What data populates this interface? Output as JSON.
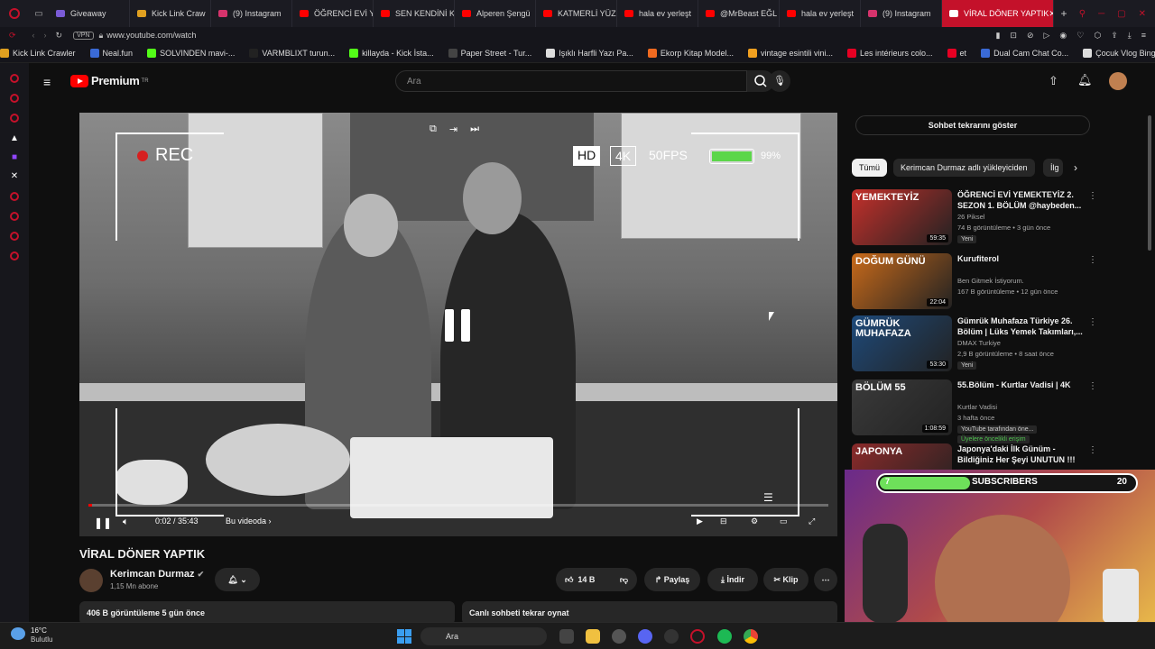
{
  "browser": {
    "tabs": [
      {
        "label": "Giveaway",
        "color": "#7a5bd6"
      },
      {
        "label": "Kick Link Craw",
        "color": "#e0a020"
      },
      {
        "label": "(9) Instagram",
        "color": "#d6336c"
      },
      {
        "label": "ÖĞRENCİ EVİ Y",
        "color": "#ff0000"
      },
      {
        "label": "SEN KENDİNİ K",
        "color": "#ff0000"
      },
      {
        "label": "Alperen Şengü",
        "color": "#ff0000"
      },
      {
        "label": "KATMERLİ YÜZ",
        "color": "#ff0000"
      },
      {
        "label": "hala ev yerleşt",
        "color": "#ff0000"
      },
      {
        "label": "@MrBeast EĞL",
        "color": "#ff0000"
      },
      {
        "label": "hala ev yerleşt",
        "color": "#ff0000"
      },
      {
        "label": "(9) Instagram",
        "color": "#d6336c"
      }
    ],
    "active_tab": "VİRAL DÖNER YAPTIK",
    "vpn_label": "VPN",
    "url": "www.youtube.com/watch",
    "bookmarks": [
      {
        "label": "Kick Link Crawler",
        "color": "#e0a020"
      },
      {
        "label": "Neal.fun",
        "color": "#3a6ad6"
      },
      {
        "label": "SOLVINDEN mavi-...",
        "color": "#53fc18"
      },
      {
        "label": "VARMBLIXT turun...",
        "color": "#222"
      },
      {
        "label": "killayda - Kick İsta...",
        "color": "#53fc18"
      },
      {
        "label": "Paper Street - Tur...",
        "color": "#444"
      },
      {
        "label": "Işıklı Harfli Yazı Pa...",
        "color": "#ddd"
      },
      {
        "label": "Ekorp Kitap Model...",
        "color": "#f06a20"
      },
      {
        "label": "vintage esintili vini...",
        "color": "#f0a020"
      },
      {
        "label": "Les intérieurs colo...",
        "color": "#e60023"
      },
      {
        "label": "et",
        "color": "#e60023"
      },
      {
        "label": "Dual Cam Chat Co...",
        "color": "#3a6ad6"
      },
      {
        "label": "Çocuk Vlog Bingosu",
        "color": "#ddd"
      }
    ]
  },
  "youtube": {
    "logo_text": "Premium",
    "logo_sup": "TR",
    "search_placeholder": "Ara"
  },
  "video": {
    "rec_label": "REC",
    "hd_label": "HD",
    "k4_label": "4K",
    "fps_label": "50FPS",
    "battery_pct": "99%",
    "time": "0:02 / 35:43",
    "chapter": "Bu videoda",
    "progress_fraction": 0.001
  },
  "meta": {
    "title": "VİRAL DÖNER YAPTIK",
    "channel": "Kerimcan Durmaz",
    "subscribers": "1,15 Mn abone",
    "likes": "14 B",
    "share": "Paylaş",
    "download": "İndir",
    "clip": "Klip",
    "views_date": "406 B görüntüleme  5 gün önce",
    "chat_replay": "Canlı sohbeti tekrar oynat"
  },
  "sidebar": {
    "chat_button": "Sohbet tekrarını göster",
    "chips": [
      "Tümü",
      "Kerimcan Durmaz adlı yükleyiciden",
      "İlg"
    ],
    "items": [
      {
        "title": "ÖĞRENCİ EVİ YEMEKTEYİZ 2. SEZON 1. BÖLÜM @haybeden...",
        "channel": "26 Piksel",
        "meta": "74 B görüntüleme • 3 gün önce",
        "badge": "Yeni",
        "duration": "59:35",
        "thumb_text": "YEMEKTEYİZ",
        "thumb_color": "#c4302b"
      },
      {
        "title": "Kurufiterol",
        "channel": "Ben Gitmek İstiyorum.",
        "meta": "167 B görüntüleme • 12 gün önce",
        "badge": "",
        "duration": "22:04",
        "thumb_text": "DOĞUM GÜNÜ",
        "thumb_color": "#c86a1a"
      },
      {
        "title": "Gümrük Muhafaza Türkiye 26. Bölüm | Lüks Yemek Takımları,...",
        "channel": "DMAX Turkiye",
        "meta": "2,9 B görüntüleme • 8 saat önce",
        "badge": "Yeni",
        "duration": "53:30",
        "thumb_text": "GÜMRÜK MUHAFAZA",
        "thumb_color": "#1e4a7a"
      },
      {
        "title": "55.Bölüm - Kurtlar Vadisi | 4K",
        "channel": "Kurtlar Vadisi",
        "meta": "3 hafta önce",
        "badge": "YouTube tarafından öne...",
        "badge2": "Üyelere öncelikli erişim",
        "duration": "1:08:59",
        "thumb_text": "BÖLÜM 55",
        "thumb_color": "#3a3a3a"
      },
      {
        "title": "Japonya'daki İlk Günüm - Bildiğiniz Her Şeyi UNUTUN !!!",
        "channel": "",
        "meta": "",
        "badge": "",
        "duration": "",
        "thumb_text": "JAPONYA",
        "thumb_color": "#8a2a2a"
      }
    ]
  },
  "overlay": {
    "sub_count_left": "7",
    "sub_label": "SUBSCRIBERS",
    "sub_count_right": "20",
    "sub_progress_fraction": 0.35
  },
  "taskbar": {
    "weather_temp": "16°C",
    "weather_desc": "Bulutlu",
    "search_label": "Ara"
  },
  "colors": {
    "accent": "#ff0000",
    "browser_accent": "#c4112a",
    "like_green": "#6ee05a"
  }
}
